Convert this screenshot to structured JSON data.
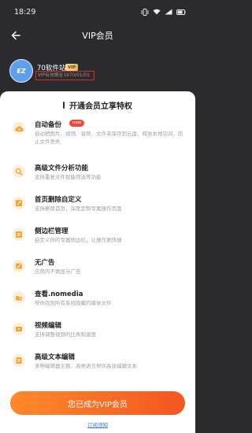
{
  "status_bar": {
    "time": "18:29",
    "icons": [
      "vibrate-icon",
      "wifi-icon",
      "signal-icon",
      "battery-icon"
    ]
  },
  "header": {
    "back_icon": "back-arrow-icon",
    "title": "VIP会员"
  },
  "profile": {
    "avatar_text": "EZ",
    "username": "70软件站",
    "vip_badge": "VIP",
    "expiry_text": "VIP有效期至1970/01/01"
  },
  "section": {
    "title": "开通会员立享特权"
  },
  "features": [
    {
      "icon": "cloud-backup-icon",
      "title": "自动备份",
      "badge": "new",
      "desc": "自动把图片、视频、音频、文件夹保存到云盘，释放本地空间，防止文件丢失"
    },
    {
      "icon": "file-analysis-icon",
      "title": "高级文件分析功能",
      "desc": "支持重复文件智能筛选等功能"
    },
    {
      "icon": "home-custom-icon",
      "title": "首页删除自定义",
      "desc": "支持删除首页，深度定制专属操作页面"
    },
    {
      "icon": "sidebar-icon",
      "title": "侧边栏管理",
      "desc": "自定义你的专属侧边栏，让操作更快捷"
    },
    {
      "icon": "no-ads-icon",
      "title": "无广告",
      "desc": "应用内不再显示广告"
    },
    {
      "icon": "nomedia-icon",
      "title": "查看.nomedia",
      "desc": "帮你找到所有系统隐藏的媒体文件"
    },
    {
      "icon": "video-edit-icon",
      "title": "视频编辑",
      "desc": "支持调整视频的比例和速度"
    },
    {
      "icon": "text-edit-icon",
      "title": "高级文本编辑",
      "desc": "多种编辑器主题，高亮语言帮你高效编辑文本"
    }
  ],
  "cta": {
    "label": "您已成为VIP会员"
  },
  "footer": {
    "link": "订阅须知"
  },
  "colors": {
    "header_bg": "#2b2b2e",
    "accent": "#f56a22",
    "icon_bg": "#fbefd8",
    "icon_fg": "#f0a43a",
    "link": "#3a78d8"
  }
}
